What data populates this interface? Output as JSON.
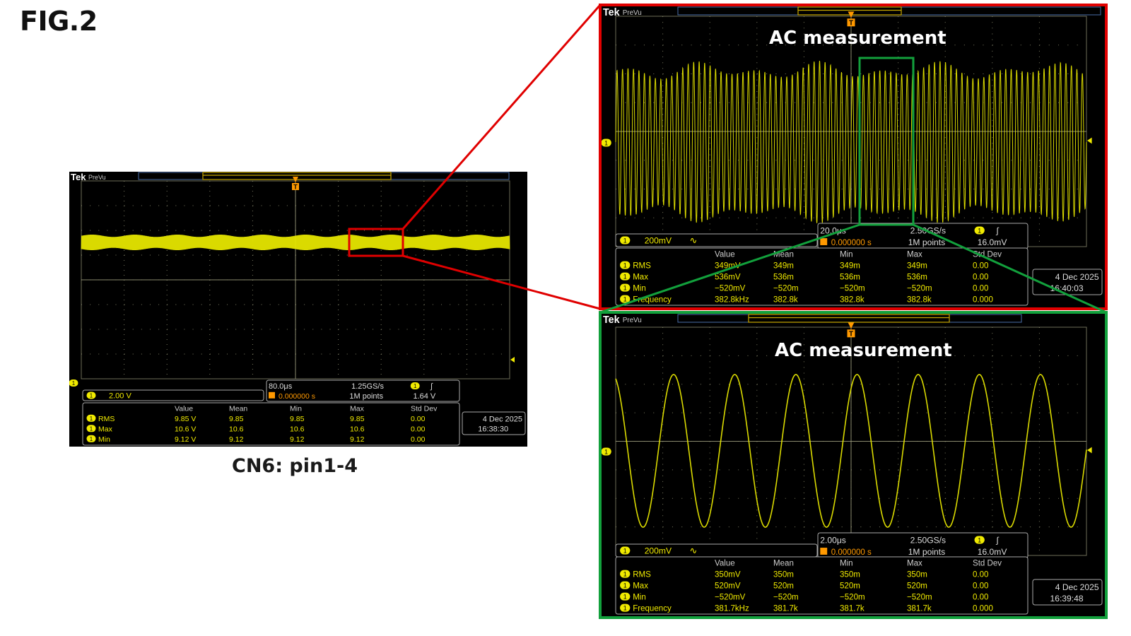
{
  "figure": {
    "title": "FIG.2",
    "caption": "CN6: pin1-4"
  },
  "colors": {
    "trace": "#e6e600",
    "channel_badge": "#f0ea00",
    "grid": "#9a9a7a",
    "zoom_frame": "#e00000",
    "zoom2_frame": "#12a03c",
    "orange": "#ff9900"
  },
  "scopes": [
    {
      "id": "overview",
      "header": {
        "brand": "Tek",
        "mode": "PreVu"
      },
      "trigger_marker": "T",
      "channel_marker": "1",
      "ac_label": "",
      "channel_setting": {
        "badge": "1",
        "scale": "2.00 V",
        "coupling_icon": ""
      },
      "horizontal": {
        "time_per_div": "80.0μs",
        "sample_rate": "1.25GS/s",
        "trigger_delay": "0.000000 s",
        "record_length": "1M points",
        "trigger_level": "1.64 V"
      },
      "timestamp": {
        "date": "4 Dec  2025",
        "time": "16:38:30"
      },
      "measurement_headers": [
        "Value",
        "Mean",
        "Min",
        "Max",
        "Std Dev"
      ],
      "measurements": [
        {
          "badge": "1",
          "name": "RMS",
          "values": [
            "9.85 V",
            "9.85",
            "9.85",
            "9.85",
            "0.00"
          ]
        },
        {
          "badge": "1",
          "name": "Max",
          "values": [
            "10.6 V",
            "10.6",
            "10.6",
            "10.6",
            "0.00"
          ]
        },
        {
          "badge": "1",
          "name": "Min",
          "values": [
            "9.12 V",
            "9.12",
            "9.12",
            "9.12",
            "0.00"
          ]
        }
      ]
    },
    {
      "id": "zoom1",
      "header": {
        "brand": "Tek",
        "mode": "PreVu"
      },
      "trigger_marker": "T",
      "channel_marker": "1",
      "ac_label": "AC measurement",
      "channel_setting": {
        "badge": "1",
        "scale": "200mV",
        "coupling_icon": "∿"
      },
      "horizontal": {
        "time_per_div": "20.0μs",
        "sample_rate": "2.50GS/s",
        "trigger_delay": "0.000000 s",
        "record_length": "1M points",
        "trigger_level": "16.0mV"
      },
      "timestamp": {
        "date": "4 Dec  2025",
        "time": "16:40:03"
      },
      "measurement_headers": [
        "Value",
        "Mean",
        "Min",
        "Max",
        "Std Dev"
      ],
      "measurements": [
        {
          "badge": "1",
          "name": "RMS",
          "values": [
            "349mV",
            "349m",
            "349m",
            "349m",
            "0.00"
          ]
        },
        {
          "badge": "1",
          "name": "Max",
          "values": [
            "536mV",
            "536m",
            "536m",
            "536m",
            "0.00"
          ]
        },
        {
          "badge": "1",
          "name": "Min",
          "values": [
            "−520mV",
            "−520m",
            "−520m",
            "−520m",
            "0.00"
          ]
        },
        {
          "badge": "1",
          "name": "Frequency",
          "values": [
            "382.8kHz",
            "382.8k",
            "382.8k",
            "382.8k",
            "0.000"
          ]
        }
      ]
    },
    {
      "id": "zoom2",
      "header": {
        "brand": "Tek",
        "mode": "PreVu"
      },
      "trigger_marker": "T",
      "channel_marker": "1",
      "ac_label": "AC measurement",
      "channel_setting": {
        "badge": "1",
        "scale": "200mV",
        "coupling_icon": "∿"
      },
      "horizontal": {
        "time_per_div": "2.00μs",
        "sample_rate": "2.50GS/s",
        "trigger_delay": "0.000000 s",
        "record_length": "1M points",
        "trigger_level": "16.0mV"
      },
      "timestamp": {
        "date": "4 Dec  2025",
        "time": "16:39:48"
      },
      "measurement_headers": [
        "Value",
        "Mean",
        "Min",
        "Max",
        "Std Dev"
      ],
      "measurements": [
        {
          "badge": "1",
          "name": "RMS",
          "values": [
            "350mV",
            "350m",
            "350m",
            "350m",
            "0.00"
          ]
        },
        {
          "badge": "1",
          "name": "Max",
          "values": [
            "520mV",
            "520m",
            "520m",
            "520m",
            "0.00"
          ]
        },
        {
          "badge": "1",
          "name": "Min",
          "values": [
            "−520mV",
            "−520m",
            "−520m",
            "−520m",
            "0.00"
          ]
        },
        {
          "badge": "1",
          "name": "Frequency",
          "values": [
            "381.7kHz",
            "381.7k",
            "381.7k",
            "381.7k",
            "0.000"
          ]
        }
      ]
    }
  ]
}
